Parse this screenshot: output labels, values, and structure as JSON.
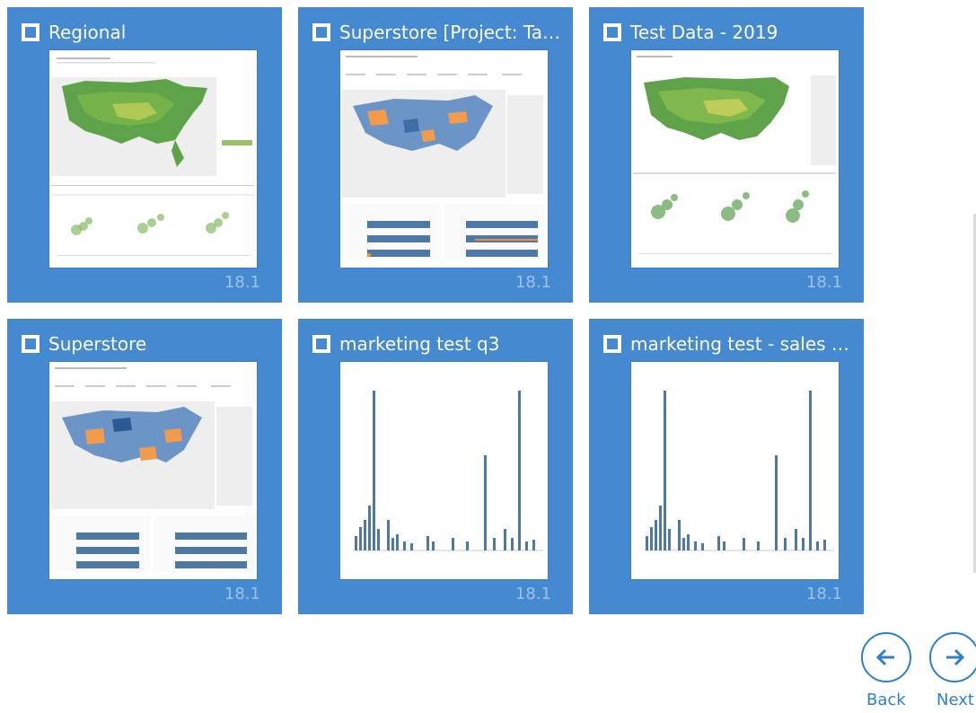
{
  "tiles": [
    {
      "title": "Regional",
      "version": "18.1",
      "thumb": "regional-dashboard-thumbnail"
    },
    {
      "title": "Superstore [Project: Tabl...",
      "version": "18.1",
      "thumb": "superstore-dashboard-thumbnail"
    },
    {
      "title": "Test Data - 2019",
      "version": "18.1",
      "thumb": "regional-dashboard-thumbnail"
    },
    {
      "title": "Superstore",
      "version": "18.1",
      "thumb": "superstore-dashboard-thumbnail"
    },
    {
      "title": "marketing test q3",
      "version": "18.1",
      "thumb": "bar-chart-thumbnail"
    },
    {
      "title": "marketing test - sales b...",
      "version": "18.1",
      "thumb": "bar-chart-thumbnail"
    }
  ],
  "nav": {
    "back_label": "Back",
    "next_label": "Next"
  },
  "colors": {
    "tile_bg": "#4589d0",
    "accent": "#2d7fd0",
    "version_text": "#9cc2ea"
  }
}
